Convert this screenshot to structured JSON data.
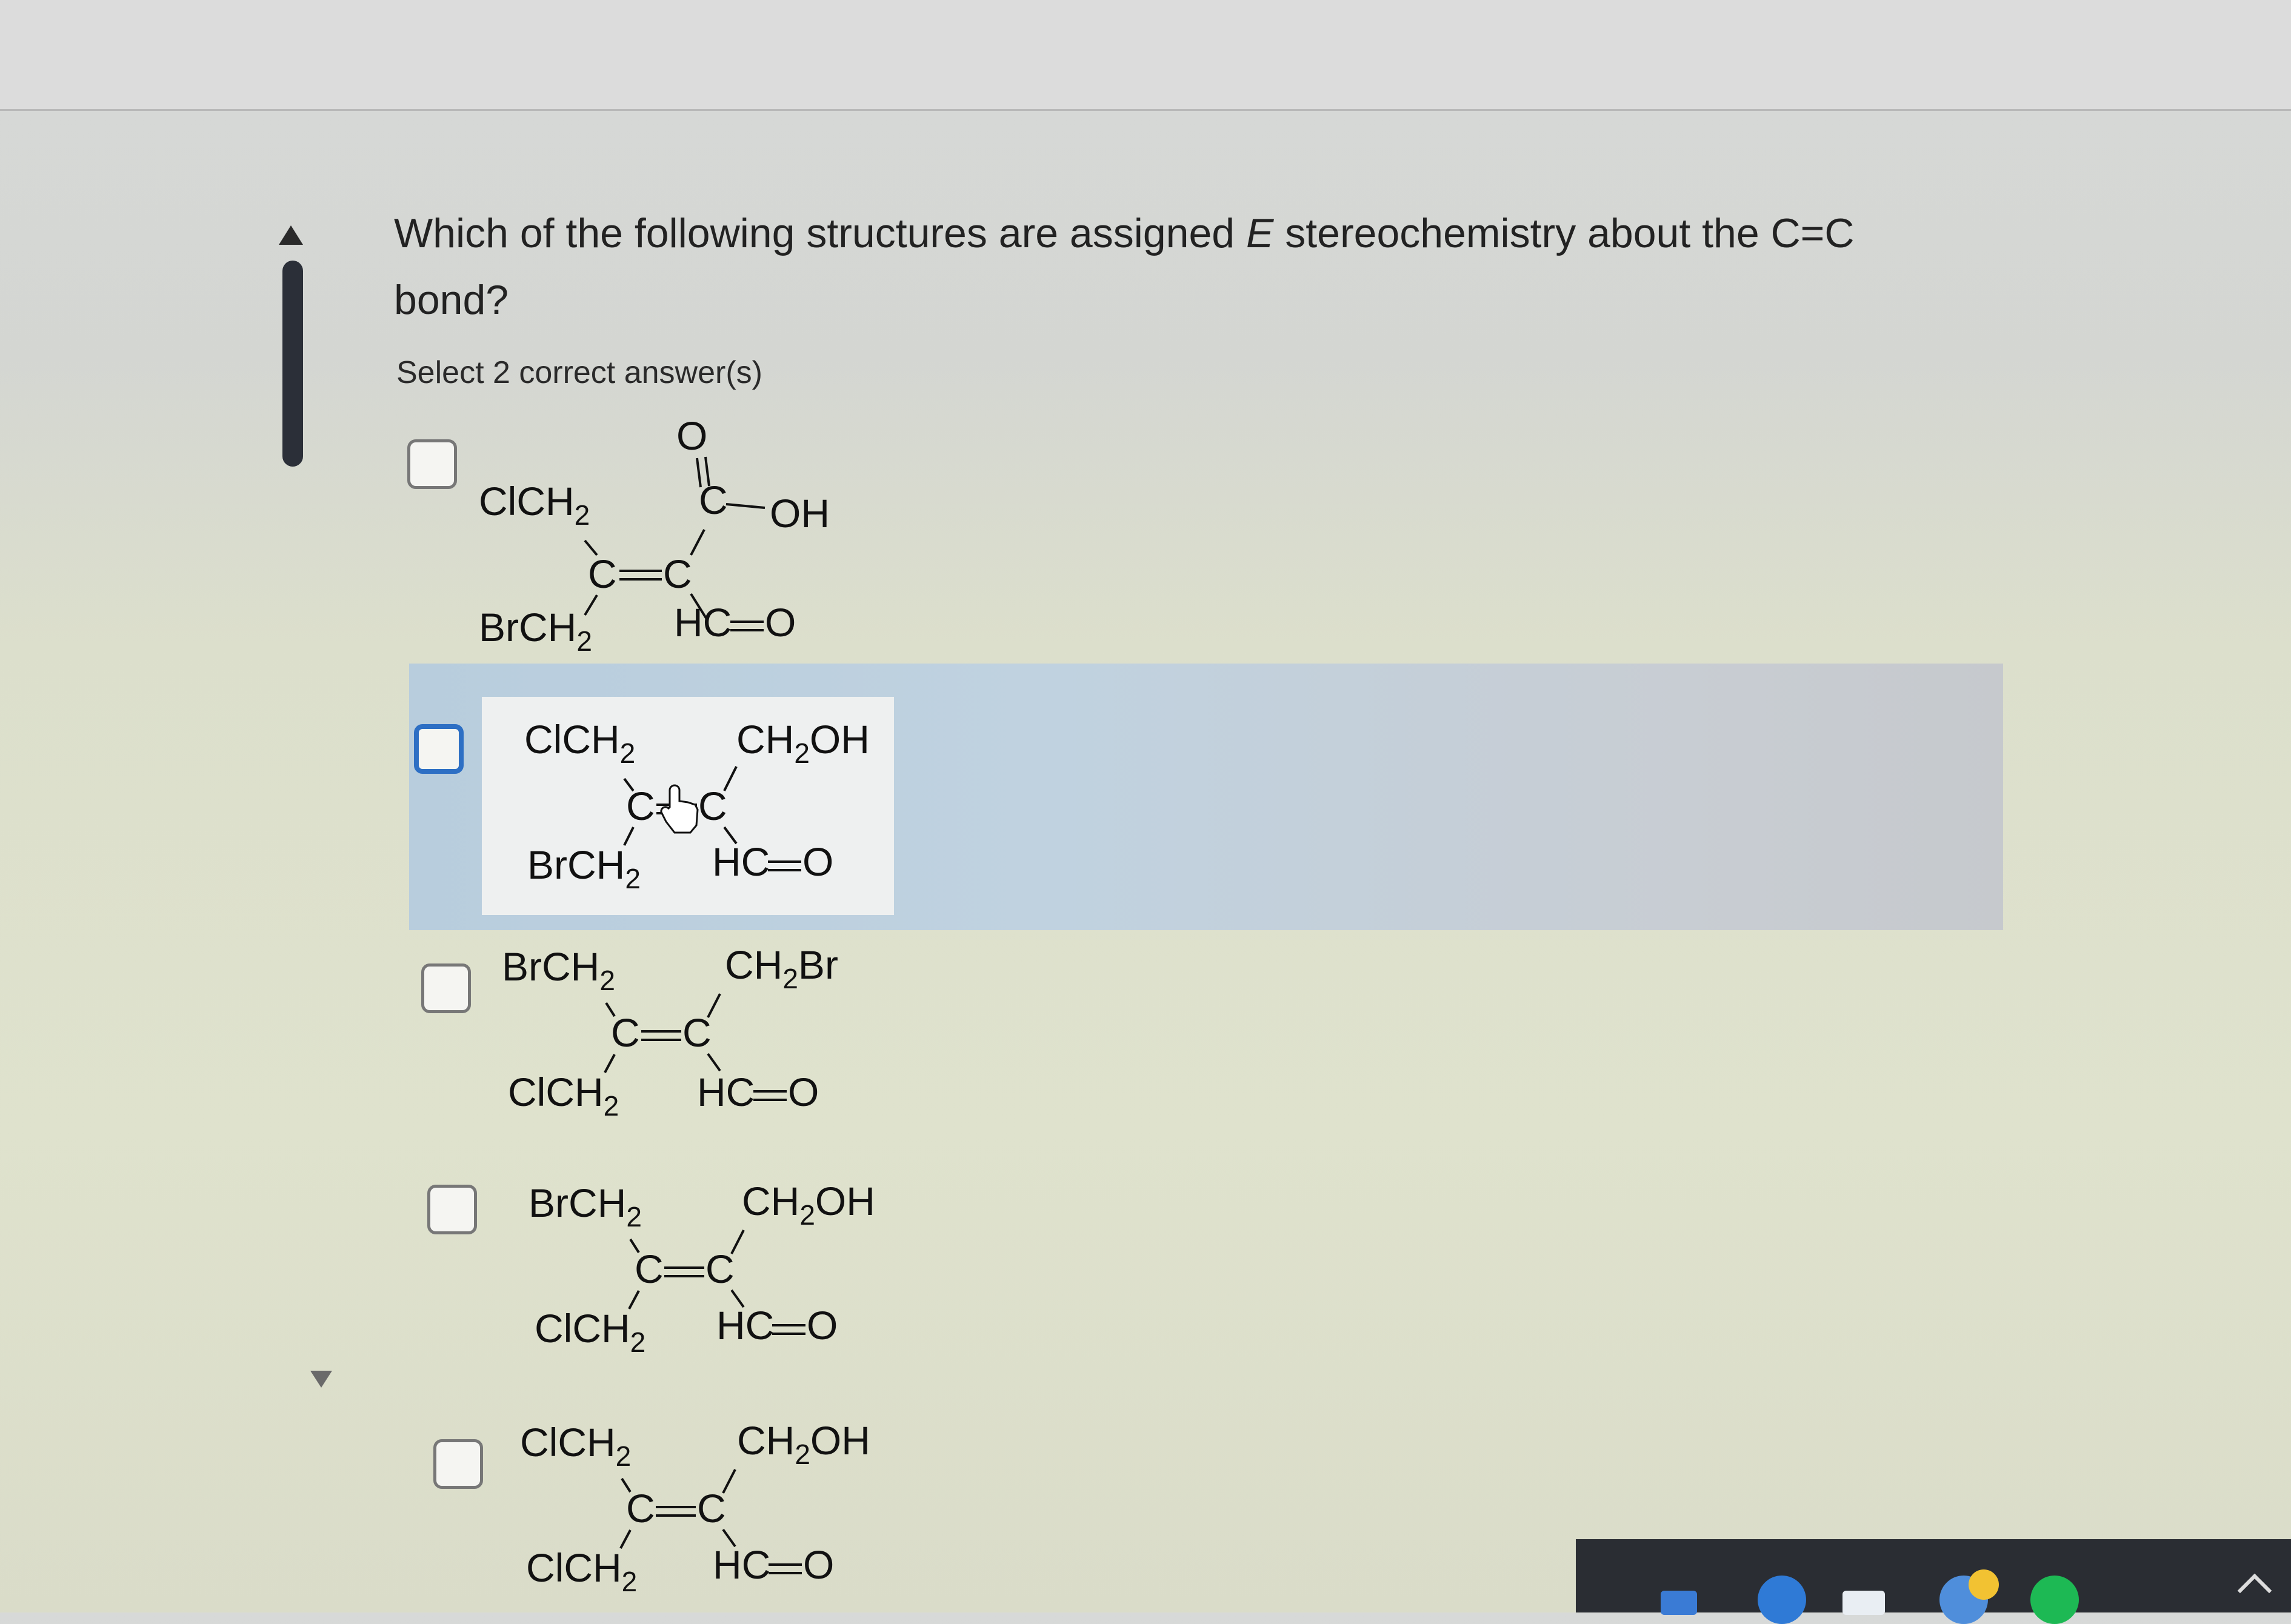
{
  "question": {
    "text_before": "Which of the following structures are assigned ",
    "italic": "E",
    "text_after": " stereochemistry about the C=C bond?"
  },
  "instruction": "Select 2 correct answer(s)",
  "options": [
    {
      "top_left": "ClCH",
      "bottom_left": "BrCH",
      "top_right_C": "C",
      "top_right_oh": "OH",
      "carbonyl_O": "O",
      "bottom_right": "HC",
      "bottom_right_O": "O",
      "checked": false
    },
    {
      "top_left": "ClCH",
      "bottom_left": "BrCH",
      "top_right": "CH",
      "top_right_tail": "OH",
      "bottom_right": "HC",
      "bottom_right_O": "O",
      "checked": false,
      "hovered": true
    },
    {
      "top_left": "BrCH",
      "bottom_left": "ClCH",
      "top_right": "CH",
      "top_right_tail": "Br",
      "bottom_right": "HC",
      "bottom_right_O": "O",
      "checked": false
    },
    {
      "top_left": "BrCH",
      "bottom_left": "ClCH",
      "top_right": "CH",
      "top_right_tail": "OH",
      "bottom_right": "HC",
      "bottom_right_O": "O",
      "checked": false
    },
    {
      "top_left": "ClCH",
      "bottom_left": "ClCH",
      "top_right": "CH",
      "top_right_tail": "OH",
      "bottom_right": "HC",
      "bottom_right_O": "O",
      "checked": false
    }
  ],
  "common": {
    "subscript": "2",
    "carbon": "C",
    "double_bond": "="
  },
  "icons": {
    "scroll_up": "triangle-up-icon",
    "scroll_down": "triangle-down-icon",
    "cursor": "hand-pointer-icon",
    "tray_chevron": "chevron-up-icon"
  }
}
